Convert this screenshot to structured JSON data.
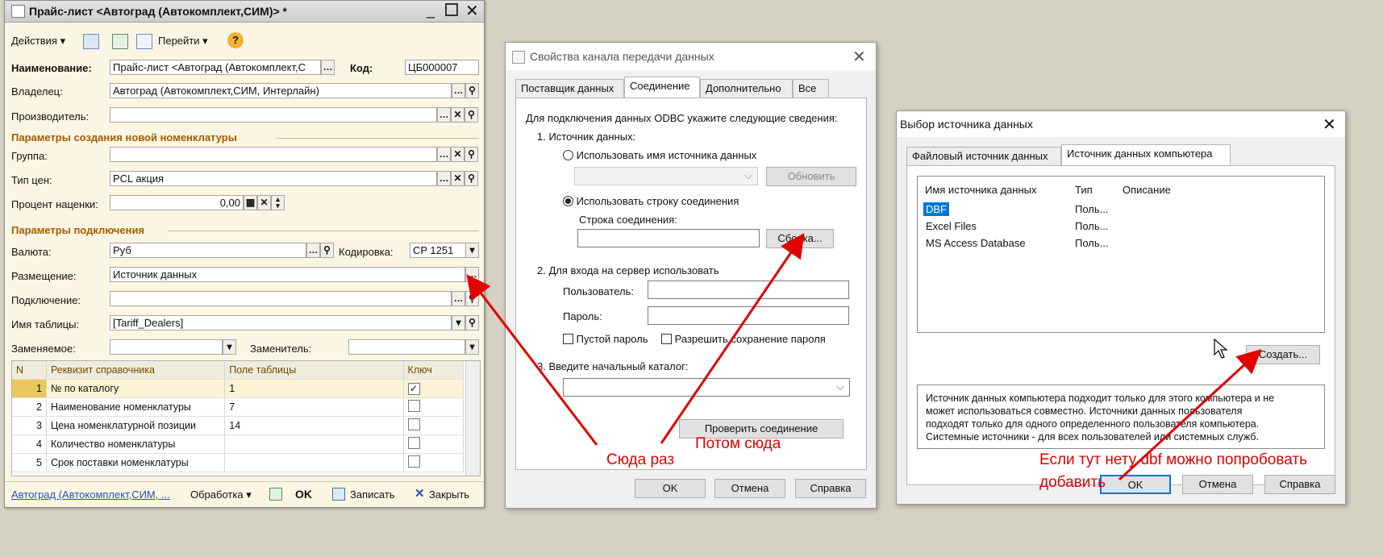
{
  "w1": {
    "title": "Прайс-лист <Автоград (Автокомплект,СИМ)> *",
    "toolbar": {
      "actions": "Действия",
      "go": "Перейти"
    },
    "fields": {
      "name_label": "Наименование:",
      "name_value": "Прайс-лист <Автоград (Автокомплект,С",
      "code_label": "Код:",
      "code_value": "ЦБ000007",
      "owner_label": "Владелец:",
      "owner_value": "Автоград (Автокомплект,СИМ, Интерлайн)",
      "producer_label": "Производитель:",
      "section_new": "Параметры создания новой номенклатуры",
      "group_label": "Группа:",
      "price_type_label": "Тип цен:",
      "price_type_value": "PCL акция",
      "markup_label": "Процент наценки:",
      "markup_value": "0,00",
      "section_conn": "Параметры подключения",
      "currency_label": "Валюта:",
      "currency_value": "Руб",
      "encoding_label": "Кодировка:",
      "encoding_value": "CP 1251",
      "placement_label": "Размещение:",
      "placement_value": "Источник данных",
      "connection_label": "Подключение:",
      "table_label": "Имя таблицы:",
      "table_value": "[Tariff_Dealers]",
      "replaced_label": "Заменяемое:",
      "replacer_label": "Заменитель:"
    },
    "grid": {
      "headers": [
        "N",
        "Реквизит справочника",
        "Поле таблицы",
        "Ключ"
      ],
      "rows": [
        {
          "n": "1",
          "name": "№ по каталогу",
          "field": "1",
          "key": true
        },
        {
          "n": "2",
          "name": "Наименование номенклатуры",
          "field": "7",
          "key": false
        },
        {
          "n": "3",
          "name": "Цена номенклатурной позиции",
          "field": "14",
          "key": false
        },
        {
          "n": "4",
          "name": "Количество номенклатуры",
          "field": "",
          "key": false
        },
        {
          "n": "5",
          "name": "Срок поставки номенклатуры",
          "field": "",
          "key": false
        }
      ]
    },
    "footer": {
      "link": "Автоград (Автокомплект,СИМ, ...",
      "process": "Обработка",
      "ok": "OK",
      "save": "Записать",
      "close": "Закрыть"
    }
  },
  "d1": {
    "title": "Свойства канала передачи данных",
    "tabs": [
      "Поставщик данных",
      "Соединение",
      "Дополнительно",
      "Все"
    ],
    "intro": "Для подключения данных ODBC укажите следующие сведения:",
    "s1": "1. Источник данных:",
    "r1": "Использовать имя источника данных",
    "refresh": "Обновить",
    "r2": "Использовать строку соединения",
    "conn_label": "Строка соединения:",
    "build": "Сборка...",
    "s2": "2. Для входа на сервер использовать",
    "user_label": "Пользователь:",
    "pass_label": "Пароль:",
    "empty_pass": "Пустой пароль",
    "save_pass": "Разрешить сохранение пароля",
    "s3": "3. Введите начальный каталог:",
    "test": "Проверить соединение",
    "ok": "OK",
    "cancel": "Отмена",
    "help": "Справка"
  },
  "d2": {
    "title": "Выбор источника данных",
    "tabs": [
      "Файловый источник данных",
      "Источник данных компьютера"
    ],
    "cols": [
      "Имя источника данных",
      "Тип",
      "Описание"
    ],
    "rows": [
      {
        "name": "DBF",
        "type": "Поль..."
      },
      {
        "name": "Excel Files",
        "type": "Поль..."
      },
      {
        "name": "MS Access Database",
        "type": "Поль..."
      }
    ],
    "create": "Создать...",
    "desc": [
      "Источник данных компьютера подходит только для этого компьютера и не",
      "может использоваться совместно.  Источники данных пользователя",
      "подходят только для одного определенного пользователя компьютера.",
      "Системные источники - для всех пользователей или системных служб."
    ],
    "ok": "OK",
    "cancel": "Отмена",
    "help": "Справка"
  },
  "notes": {
    "first": "Сюда раз",
    "then": "Потом сюда",
    "hint1": "Если тут нету dbf можно попробовать",
    "hint2": "добавить"
  }
}
